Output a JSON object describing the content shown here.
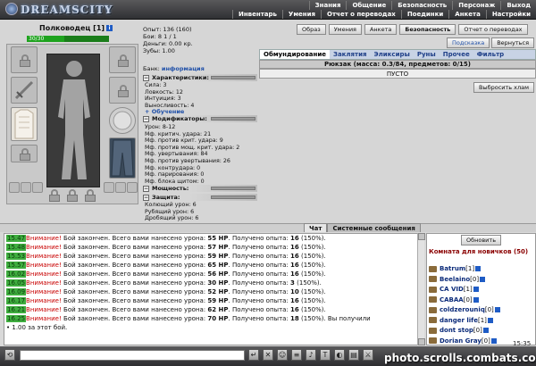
{
  "header": {
    "logo": "DREAMSCITY",
    "menu_top": [
      "Знания",
      "Общение",
      "Безопасность",
      "Персонаж",
      "Выход"
    ],
    "menu_bottom": [
      "Инвентарь",
      "Умения",
      "Отчет о переводах",
      "Поединки",
      "Анкета",
      "Настройки"
    ]
  },
  "character": {
    "name": "Полководец",
    "level": "[1]",
    "hp": "30/30",
    "experience": "Опыт: 136 (160)",
    "battles": "Бои: 8 1 / 1",
    "money": "Деньги: 0.00 кр.",
    "teeth": "Зубы: 1.00",
    "bank_label": "Банк:",
    "bank_link": "информация"
  },
  "sections": {
    "characteristics": "Характеристики:",
    "modifiers": "Модификаторы:",
    "power": "Мощность:",
    "protection": "Защита:",
    "training": "Обучение"
  },
  "characteristics": [
    "Сила: 3",
    "Ловкость: 12",
    "Интуиция: 3",
    "Выносливость: 4"
  ],
  "modifiers": [
    "Урон: 8-12",
    "Мф. критич. удара: 21",
    "Мф. против крит. удара: 9",
    "Мф. против мощ. крит. удара: 2",
    "Мф. увертывания: 84",
    "Мф. против увертывания: 26",
    "Мф. контрудара: 0",
    "Мф. парирования: 0",
    "Мф. блока щитом: 0"
  ],
  "protection": [
    "Колющий урон: 6",
    "Рубящий урон: 6",
    "Дробящий урон: 6"
  ],
  "top_buttons": [
    "Образ",
    "Умения",
    "Анкета",
    "Безопасность",
    "Отчет о переводах"
  ],
  "sub_buttons": [
    "Подсказка",
    "Вернуться"
  ],
  "inventory": {
    "tabs": [
      "Обмундирование",
      "Заклятия",
      "Эликсиры",
      "Руны",
      "Прочее",
      "Фильтр"
    ],
    "active_tab": "Обмундирование",
    "backpack_title": "Рюкзак (масса: 0.3/84, предметов: 0/15)",
    "empty_text": "ПУСТО",
    "drop_button": "Выбросить хлам"
  },
  "chat": {
    "tabs": [
      "Чат",
      "Системные сообщения"
    ],
    "lines": [
      {
        "time": "15.47",
        "warn": "Внимание!",
        "text": " Бой закончен. Всего вами нанесено урона: ",
        "hp": "55 HP",
        "mid": ". Получено опыта: ",
        "xp": "16",
        "pct": " (150%)."
      },
      {
        "time": "15.48",
        "warn": "Внимание!",
        "text": " Бой закончен. Всего вами нанесено урона: ",
        "hp": "57 HP",
        "mid": ". Получено опыта: ",
        "xp": "16",
        "pct": " (150%)."
      },
      {
        "time": "15.53",
        "warn": "Внимание!",
        "text": " Бой закончен. Всего вами нанесено урона: ",
        "hp": "59 HP",
        "mid": ". Получено опыта: ",
        "xp": "16",
        "pct": " (150%)."
      },
      {
        "time": "15.57",
        "warn": "Внимание!",
        "text": " Бой закончен. Всего вами нанесено урона: ",
        "hp": "65 HP",
        "mid": ". Получено опыта: ",
        "xp": "16",
        "pct": " (150%)."
      },
      {
        "time": "16.02",
        "warn": "Внимание!",
        "text": " Бой закончен. Всего вами нанесено урона: ",
        "hp": "56 HP",
        "mid": ". Получено опыта: ",
        "xp": "16",
        "pct": " (150%)."
      },
      {
        "time": "16.05",
        "warn": "Внимание!",
        "text": " Бой закончен. Всего вами нанесено урона: ",
        "hp": "30 HP",
        "mid": ". Получено опыта: ",
        "xp": "3",
        "pct": " (150%)."
      },
      {
        "time": "16.09",
        "warn": "Внимание!",
        "text": " Бой закончен. Всего вами нанесено урона: ",
        "hp": "52 HP",
        "mid": ". Получено опыта: ",
        "xp": "10",
        "pct": " (150%)."
      },
      {
        "time": "16.17",
        "warn": "Внимание!",
        "text": " Бой закончен. Всего вами нанесено урона: ",
        "hp": "59 HP",
        "mid": ". Получено опыта: ",
        "xp": "16",
        "pct": " (150%)."
      },
      {
        "time": "16.21",
        "warn": "Внимание!",
        "text": " Бой закончен. Всего вами нанесено урона: ",
        "hp": "62 HP",
        "mid": ". Получено опыта: ",
        "xp": "16",
        "pct": " (150%)."
      },
      {
        "time": "16.25",
        "warn": "Внимание!",
        "text": " Бой закончен. Всего вами нанесено урона: ",
        "hp": "70 HP",
        "mid": ". Получено опыта: ",
        "xp": "18",
        "pct": " (150%). Вы получили"
      }
    ],
    "last_line": "1.00 за этот бой."
  },
  "room": {
    "refresh": "Обновить",
    "title": "Комната для новичков (50)",
    "users": [
      {
        "name": "Batrum",
        "level": "[1]"
      },
      {
        "name": "Beelaino",
        "level": "[0]"
      },
      {
        "name": "CA VID",
        "level": "[1]"
      },
      {
        "name": "CABAA",
        "level": "[0]"
      },
      {
        "name": "coldzerouniq",
        "level": "[0]"
      },
      {
        "name": "danger life",
        "level": "[1]"
      },
      {
        "name": "dont stop",
        "level": "[0]"
      },
      {
        "name": "Dorian Gray",
        "level": "[0]"
      }
    ]
  },
  "clock": "15:35",
  "watermark": "photo.scrolls.combats.com",
  "colors": {
    "chat_time_bg": "#3fae3f",
    "warning": "#c80000",
    "tab_text": "#1f3f88",
    "username": "#0b2b7a"
  }
}
